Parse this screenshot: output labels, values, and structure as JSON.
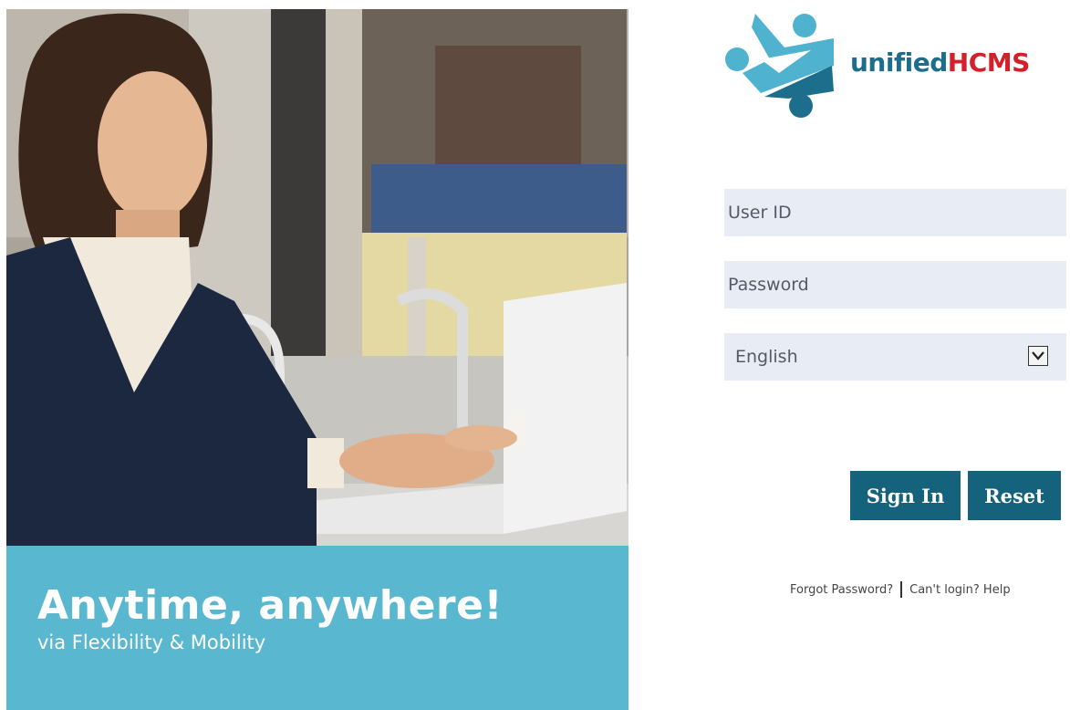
{
  "brand": {
    "name_part1": "unified",
    "name_part2": "HCMS",
    "color_primary": "#1c6e8c",
    "color_accent": "#d4202b",
    "color_light": "#4fb3cf"
  },
  "hero": {
    "tagline": "Anytime, anywhere!",
    "subtagline": "via Flexibility & Mobility",
    "banner_color": "#5ab7d0"
  },
  "login": {
    "userid_placeholder": "User ID",
    "password_placeholder": "Password",
    "language_selected": "English",
    "signin_label": "Sign In",
    "reset_label": "Reset",
    "button_color": "#15627c"
  },
  "links": {
    "forgot_password": "Forgot Password?",
    "help": "Can't login? Help"
  }
}
